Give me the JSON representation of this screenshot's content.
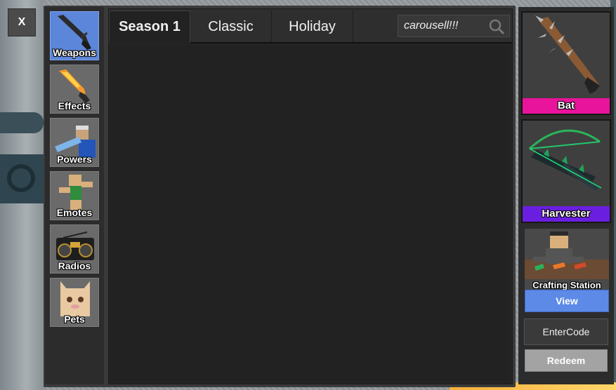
{
  "close_button": {
    "label": "X"
  },
  "sidebar": {
    "items": [
      {
        "label": "Weapons",
        "active": true
      },
      {
        "label": "Effects",
        "active": false
      },
      {
        "label": "Powers",
        "active": false
      },
      {
        "label": "Emotes",
        "active": false
      },
      {
        "label": "Radios",
        "active": false
      },
      {
        "label": "Pets",
        "active": false
      }
    ]
  },
  "tabs": [
    {
      "label": "Season 1",
      "active": true
    },
    {
      "label": "Classic",
      "active": false
    },
    {
      "label": "Holiday",
      "active": false
    }
  ],
  "search": {
    "value": "carousell!!!"
  },
  "featured_items": [
    {
      "name": "Bat",
      "color": "#e8149b"
    },
    {
      "name": "Harvester",
      "color": "#6a1fe0"
    }
  ],
  "crafting": {
    "title": "Crafting Station",
    "view_label": "View"
  },
  "code": {
    "placeholder": "EnterCode",
    "redeem_label": "Redeem"
  },
  "colors": {
    "active_tab_blue": "#5c86d9",
    "view_button": "#5c8ae6",
    "redeem_button": "#a3a3a3",
    "panel_dark": "#242424"
  }
}
